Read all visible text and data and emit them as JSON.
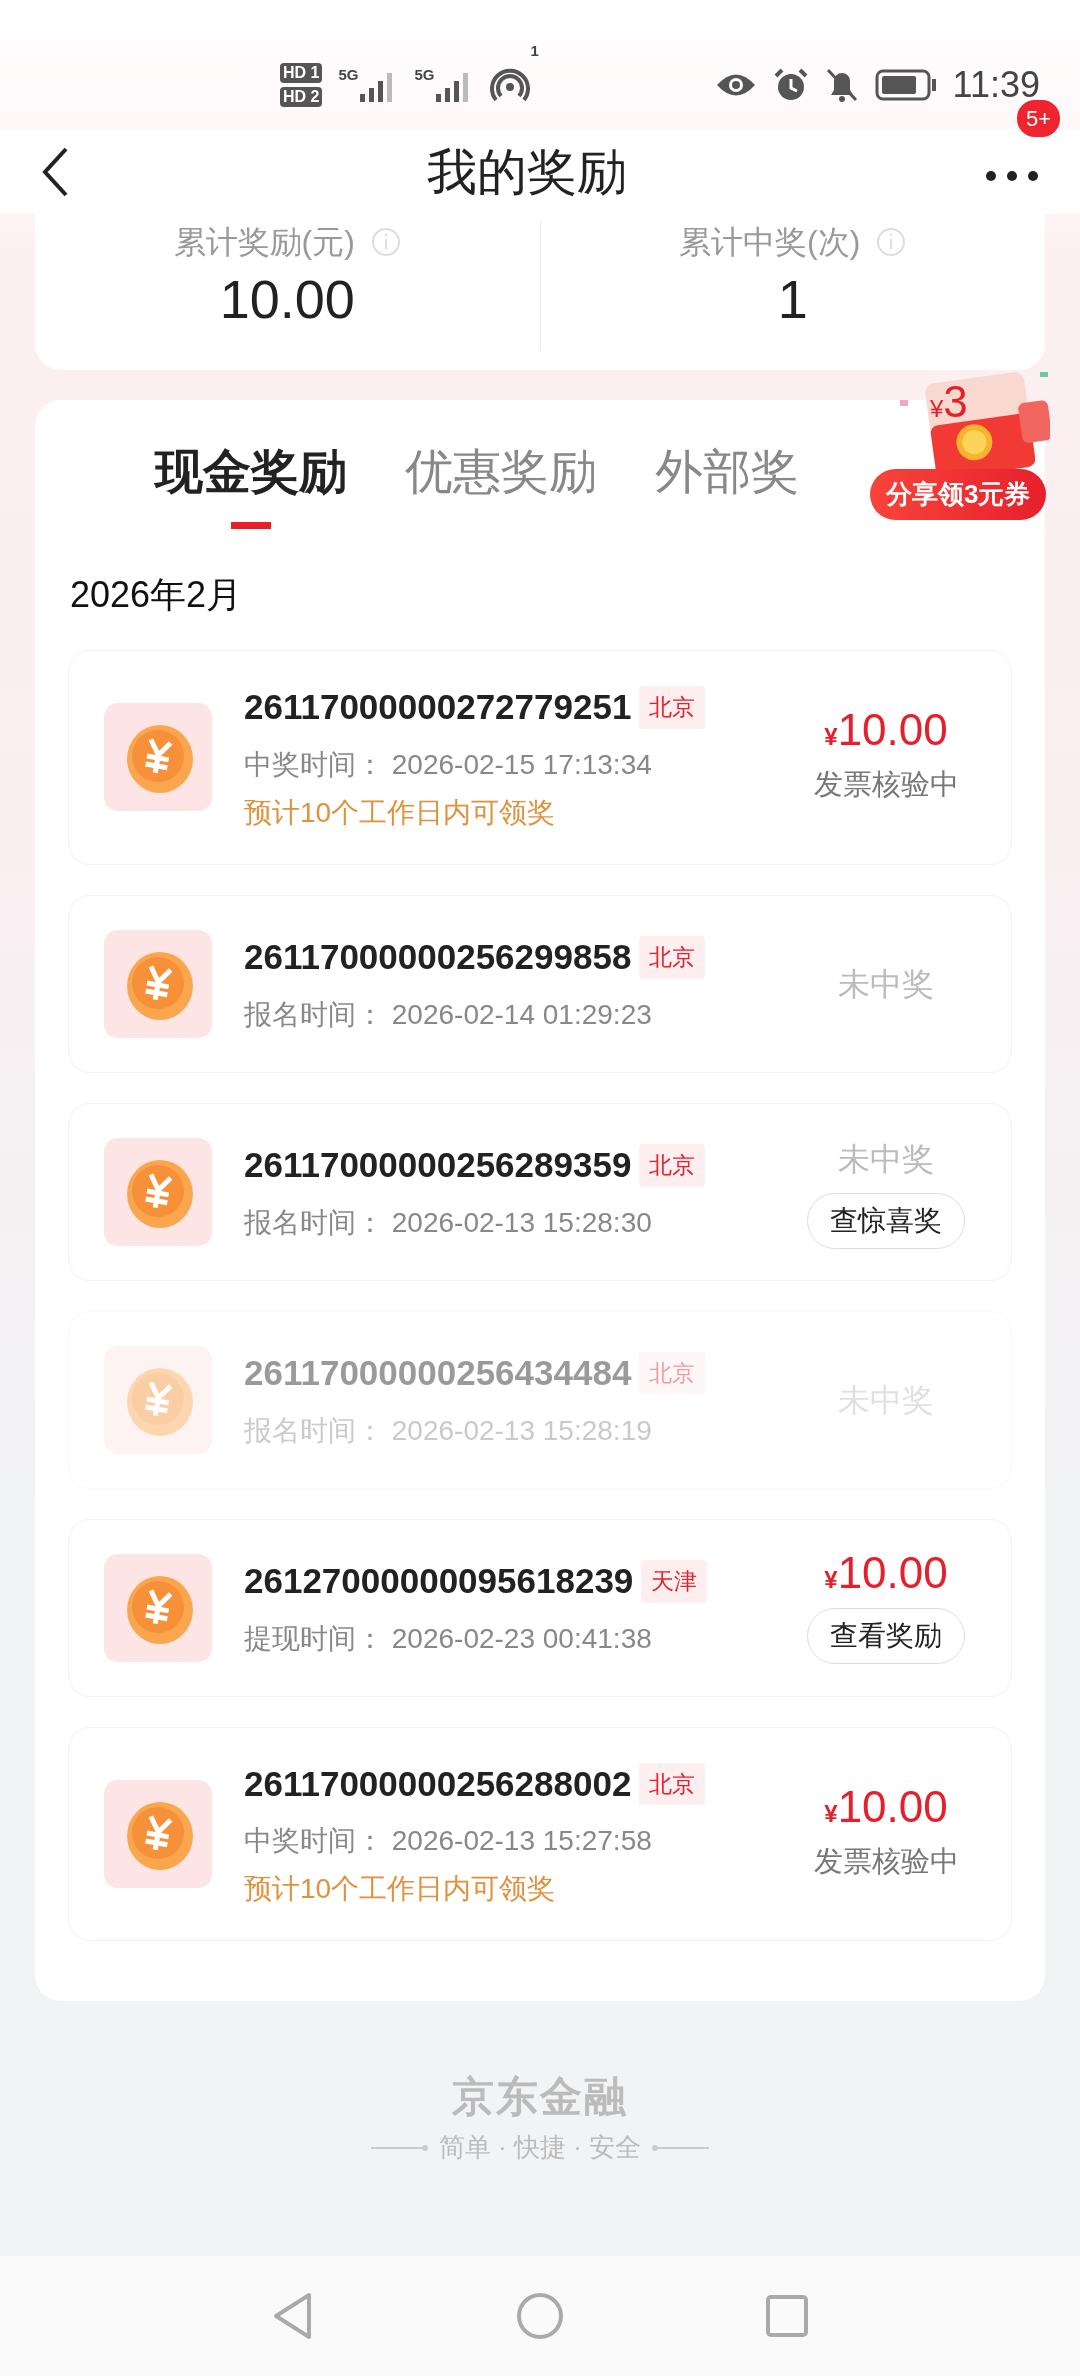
{
  "status_bar": {
    "sims": [
      "HD 1",
      "HD 2"
    ],
    "networks": [
      "5G",
      "5G"
    ],
    "hotspot_count": "1",
    "time": "11:39"
  },
  "header": {
    "title": "我的奖励",
    "badge": "5+"
  },
  "summary": [
    {
      "label": "累计奖励(元)",
      "value": "10.00"
    },
    {
      "label": "累计中奖(次)",
      "value": "1"
    }
  ],
  "tabs": [
    {
      "label": "现金奖励",
      "selected": true
    },
    {
      "label": "优惠奖励",
      "selected": false
    },
    {
      "label": "外部奖",
      "selected": false
    }
  ],
  "share_badge": {
    "amount_sign": "¥",
    "amount": "3",
    "label": "分享领3元券"
  },
  "month": "2026年2月",
  "rows": [
    {
      "id": "26117000000272779251",
      "city": "北京",
      "faded": false,
      "time_label": "中奖时间：",
      "time": "2026-02-15 17:13:34",
      "note": "预计10个工作日内可领奖",
      "currency": "¥",
      "amount": "10.00",
      "status": "发票核验中"
    },
    {
      "id": "26117000000256299858",
      "city": "北京",
      "faded": false,
      "time_label": "报名时间：",
      "time": "2026-02-14 01:29:23",
      "status": "未中奖"
    },
    {
      "id": "26117000000256289359",
      "city": "北京",
      "faded": false,
      "time_label": "报名时间：",
      "time": "2026-02-13 15:28:30",
      "status": "未中奖",
      "button": "查惊喜奖"
    },
    {
      "id": "26117000000256434484",
      "city": "北京",
      "faded": true,
      "time_label": "报名时间：",
      "time": "2026-02-13 15:28:19",
      "status": "未中奖"
    },
    {
      "id": "26127000000095618239",
      "city": "天津",
      "faded": false,
      "time_label": "提现时间：",
      "time": "2026-02-23 00:41:38",
      "currency": "¥",
      "amount": "10.00",
      "button": "查看奖励"
    },
    {
      "id": "26117000000256288002",
      "city": "北京",
      "faded": false,
      "time_label": "中奖时间：",
      "time": "2026-02-13 15:27:58",
      "note": "预计10个工作日内可领奖",
      "currency": "¥",
      "amount": "10.00",
      "status": "发票核验中"
    }
  ],
  "footer": {
    "brand": "京东金融",
    "slogan": "简单 · 快捷 · 安全"
  }
}
